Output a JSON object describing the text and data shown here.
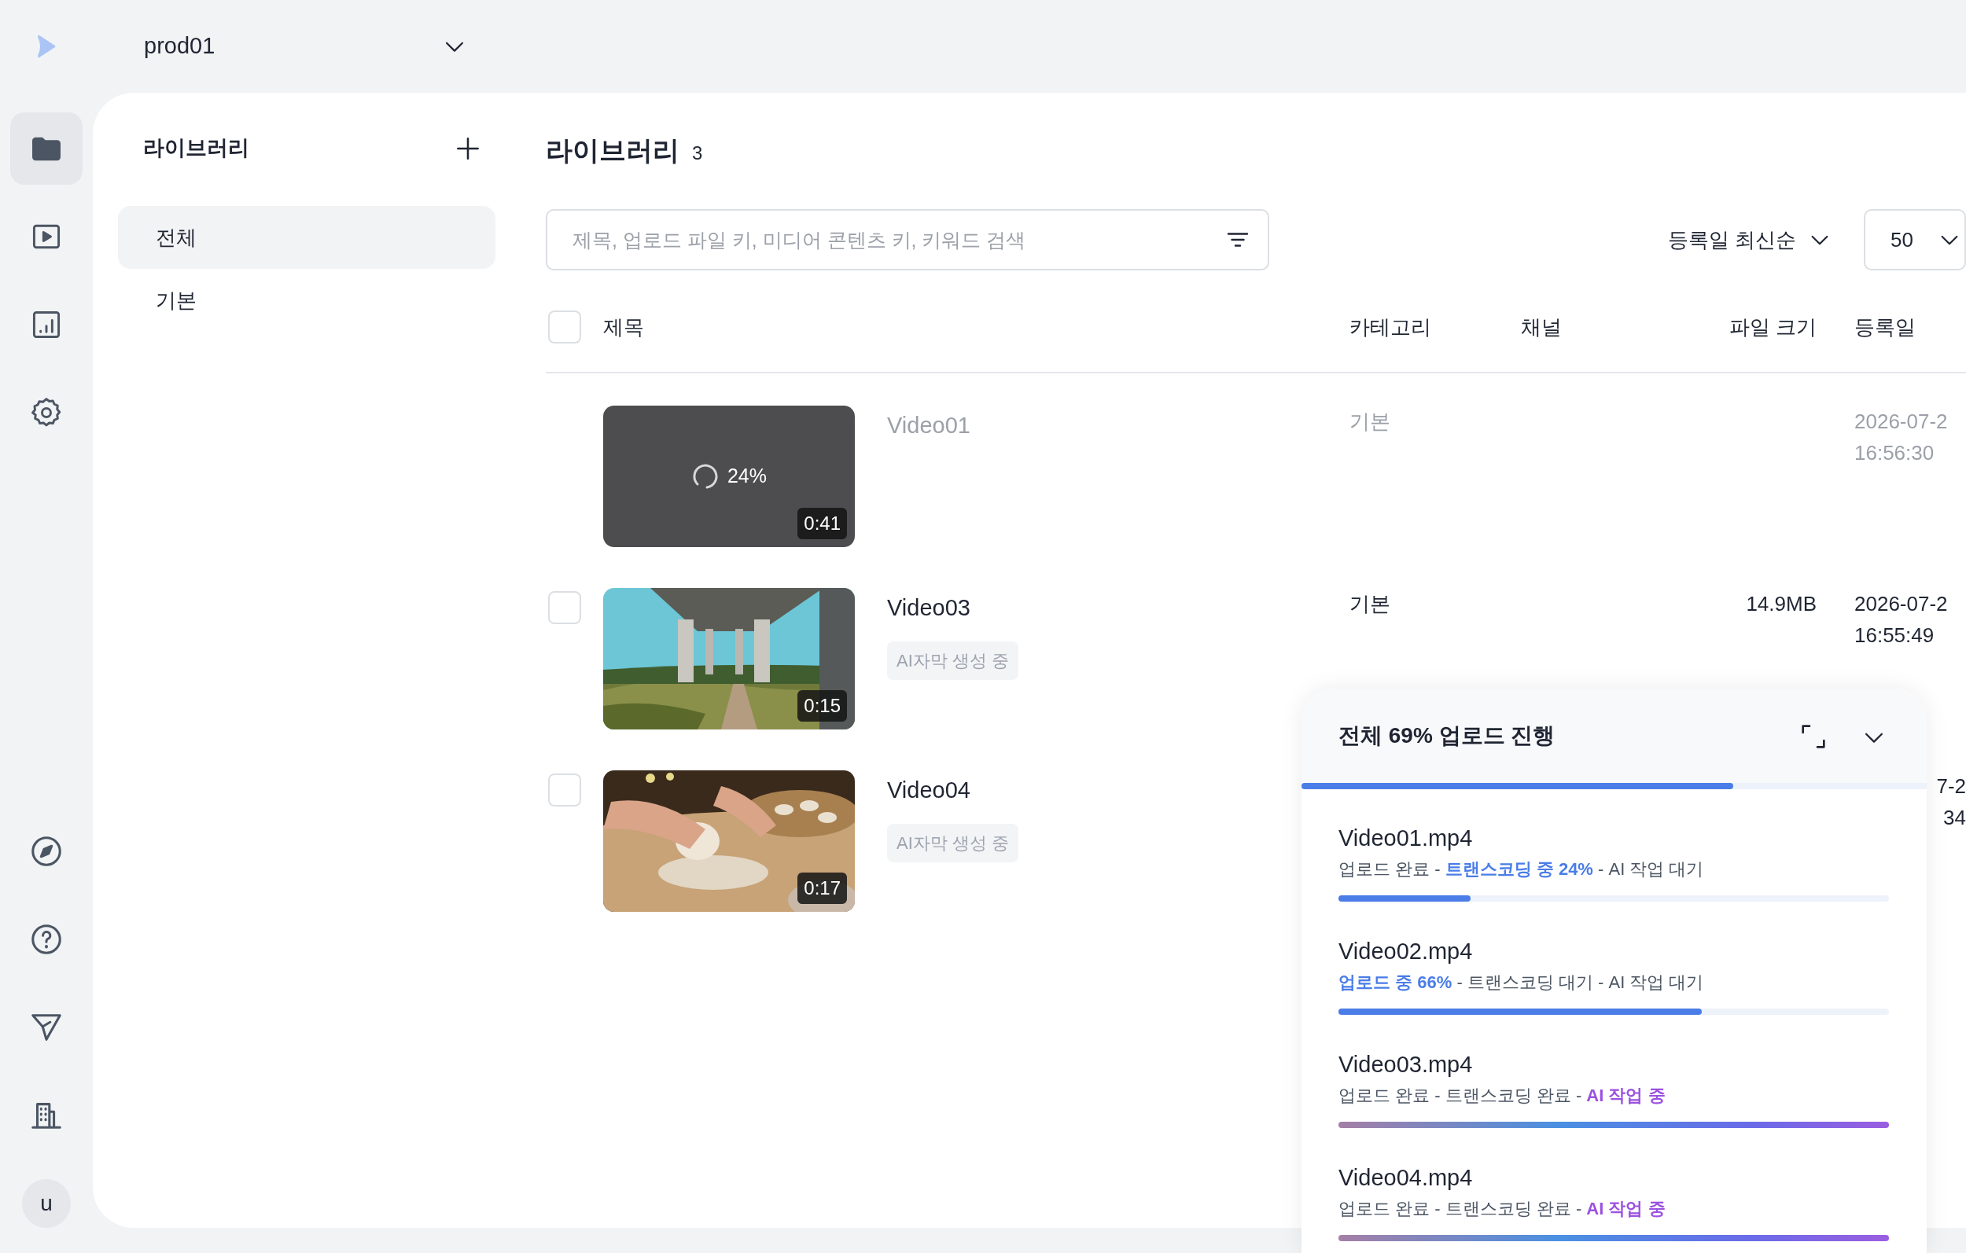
{
  "workspace": {
    "name": "prod01"
  },
  "rail": {
    "items": [
      {
        "selected": true
      },
      {
        "selected": false
      },
      {
        "selected": false
      },
      {
        "selected": false
      }
    ],
    "avatar": "u"
  },
  "library_sidebar": {
    "title": "라이브러리",
    "items": [
      {
        "label": "전체",
        "selected": true
      },
      {
        "label": "기본",
        "selected": false
      }
    ]
  },
  "library": {
    "title": "라이브러리",
    "count": "3",
    "search": {
      "placeholder": "제목, 업로드 파일 키, 미디어 콘텐츠 키, 키워드 검색"
    },
    "sort": "등록일 최신순",
    "page_size": "50",
    "table": {
      "header_checked": false,
      "columns": [
        "제목",
        "카테고리",
        "채널",
        "파일 크기",
        "등록일"
      ],
      "rows": [
        {
          "kind": "processing",
          "title": "Video01",
          "progress": "24%",
          "duration": "0:41",
          "category": "기본",
          "date": [
            "2026-07-2",
            "16:56:30"
          ]
        },
        {
          "kind": "ready",
          "checked": false,
          "title": "Video03",
          "tag": "AI자막 생성 중",
          "duration": "0:15",
          "category": "기본",
          "size": "14.9MB",
          "date": [
            "2026-07-2",
            "16:55:49"
          ]
        },
        {
          "kind": "ready",
          "checked": false,
          "title": "Video04",
          "tag": "AI자막 생성 중",
          "duration": "0:17",
          "date": [
            "7-2",
            "34"
          ]
        }
      ]
    }
  },
  "upload_panel": {
    "title": "전체 69% 업로드 진행",
    "level": 0.69,
    "items": [
      {
        "name": "Video01.mp4",
        "status": "업로드 완료 - **트랜스코딩 중 24%** - AI 작업 대기",
        "kind": "transcoding",
        "level": 0.24
      },
      {
        "name": "Video02.mp4",
        "status": "**업로드 중 66%** - 트랜스코딩 대기 - AI 작업 대기",
        "kind": "uploading",
        "level": 0.66
      },
      {
        "name": "Video03.mp4",
        "status": "업로드 완료 - 트랜스코딩 완료 - **AI 작업 중**",
        "kind": "ai",
        "level": 1
      },
      {
        "name": "Video04.mp4",
        "status": "업로드 완료 - 트랜스코딩 완료 - **AI 작업 중**",
        "kind": "ai",
        "level": 1
      }
    ]
  }
}
